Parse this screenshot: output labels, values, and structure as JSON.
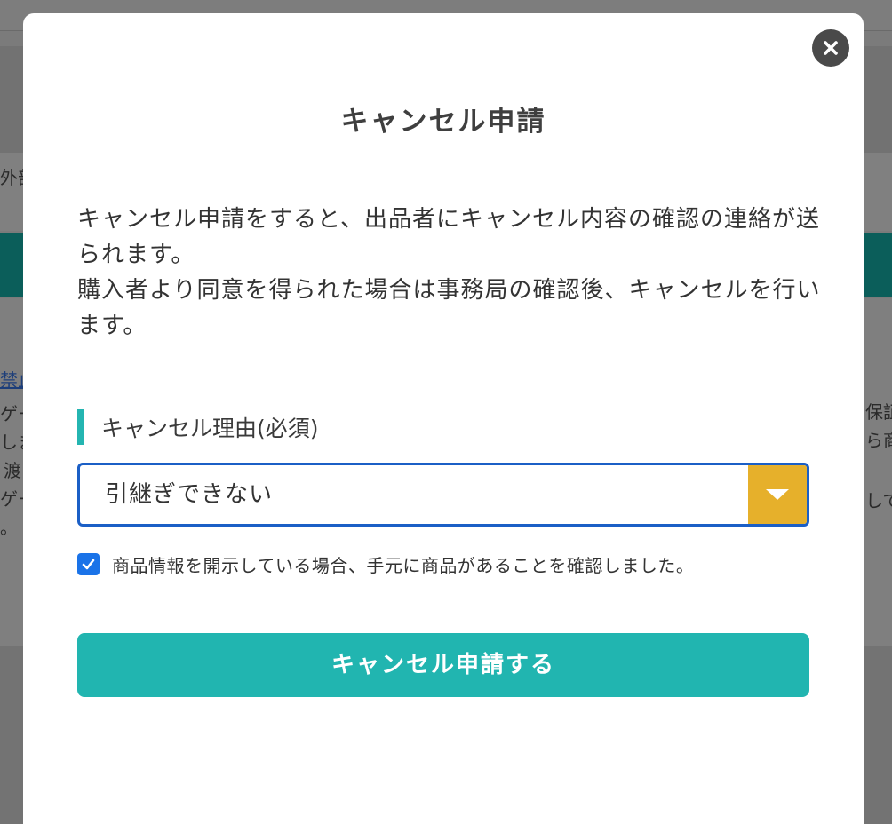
{
  "background": {
    "left_fragments": [
      "外部",
      "禁止",
      "ゲー",
      "しま",
      "渡",
      "ゲー",
      "。"
    ],
    "right_fragments": [
      "保証",
      "ら商",
      "して"
    ]
  },
  "modal": {
    "title": "キャンセル申請",
    "close_icon": "close-icon",
    "description": [
      "キャンセル申請をすると、出品者にキャンセル内容の確認の連絡が送られます。",
      "購入者より同意を得られた場合は事務局の確認後、キャンセルを行います。"
    ],
    "reason_label": "キャンセル理由(必須)",
    "reason_select": {
      "selected": "引継ぎできない"
    },
    "confirm_checkbox": {
      "checked": true,
      "label": "商品情報を開示している場合、手元に商品があることを確認しました。"
    },
    "submit_label": "キャンセル申請する"
  },
  "colors": {
    "accent_teal": "#21b5b0",
    "select_border": "#1b5fc6",
    "select_arrow_bg": "#e6b02b",
    "checkbox_blue": "#1a73e8"
  }
}
